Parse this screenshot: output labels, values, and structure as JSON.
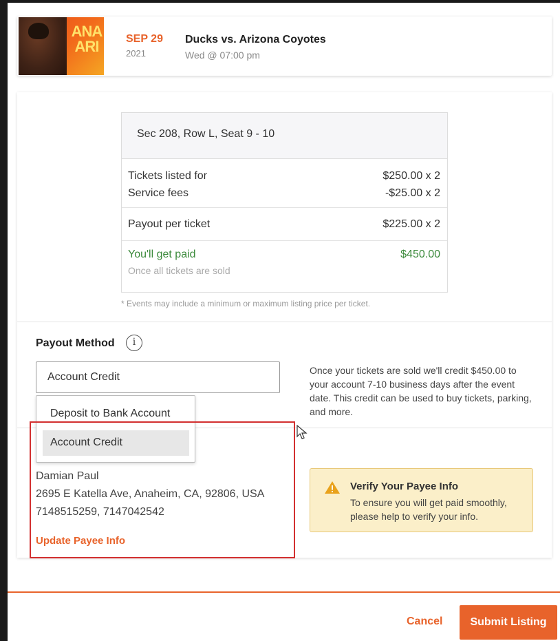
{
  "event": {
    "thumb_text": "ANA ARI",
    "month_day": "SEP 29",
    "year": "2021",
    "title": "Ducks vs. Arizona Coyotes",
    "time": "Wed @ 07:00 pm"
  },
  "summary": {
    "seat": "Sec 208, Row L, Seat 9 - 10",
    "rows": [
      {
        "label": "Tickets listed for",
        "value": "$250.00 x 2"
      },
      {
        "label": "Service fees",
        "value": "-$25.00 x 2"
      },
      {
        "label": "Payout per ticket",
        "value": "$225.00 x 2"
      }
    ],
    "paid_label": "You'll get paid",
    "paid_value": "$450.00",
    "paid_note": "Once all tickets are sold",
    "disclaimer": "* Events may include a minimum or maximum listing price per ticket."
  },
  "payout": {
    "label": "Payout Method",
    "info_icon": "i",
    "selected": "Account Credit",
    "options": [
      "Deposit to Bank Account",
      "Account Credit"
    ],
    "description": "Once your tickets are sold we'll credit $450.00 to your account 7-10 business days after the event date. This credit can be used to buy tickets, parking, and more."
  },
  "payee": {
    "name": "Damian Paul",
    "address": "2695 E Katella Ave, Anaheim, CA, 92806, USA",
    "phones": "7148515259, 7147042542",
    "update_link": "Update Payee Info"
  },
  "verify": {
    "icon": "warning-triangle-icon",
    "title": "Verify Your Payee Info",
    "body": "To ensure you will get paid smoothly, please help to verify your info."
  },
  "footer": {
    "cancel": "Cancel",
    "submit": "Submit Listing"
  },
  "colors": {
    "accent": "#e8632b",
    "paid_green": "#3b8a3b",
    "warning_bg": "#fbefc9",
    "highlight_red": "#d22f2f"
  }
}
